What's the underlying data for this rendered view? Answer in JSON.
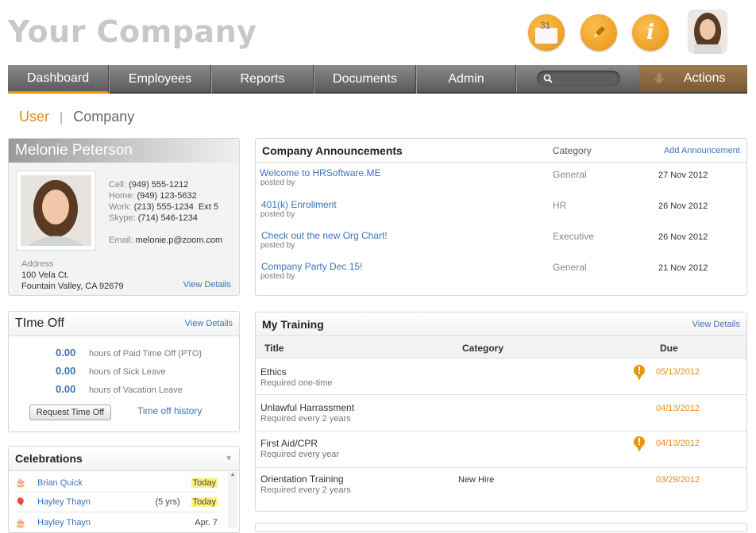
{
  "brand": {
    "logo": "Your Company"
  },
  "header": {
    "mail_badge": "31",
    "info_glyph": "i"
  },
  "nav": {
    "items": [
      "Dashboard",
      "Employees",
      "Reports",
      "Documents",
      "Admin"
    ],
    "actions": "Actions"
  },
  "context_tabs": {
    "user": "User",
    "separator": "|",
    "company": "Company"
  },
  "profile": {
    "name": "Melonie Peterson",
    "cell_label": "Cell:",
    "cell": "(949) 555-1212",
    "home_label": "Home:",
    "home": "(949) 123-5632",
    "work_label": "Work:",
    "work": "(213) 555-1234  Ext 5",
    "skype_label": "Skype:",
    "skype": "(714) 546-1234",
    "email_label": "Email:",
    "email": "melonie.p@zoom.com",
    "address_label": "Address",
    "address1": "100 Vela Ct.",
    "address2": "Fountain Valley, CA 92679",
    "view_details": "View Details"
  },
  "time_off": {
    "title": "TIme Off",
    "view_details": "View Details",
    "rows": [
      {
        "value": "0.00",
        "label": "hours of Paid Time Off (PTO)"
      },
      {
        "value": "0.00",
        "label": "hours of Sick Leave"
      },
      {
        "value": "0.00",
        "label": "hours of Vacation Leave"
      }
    ],
    "request_button": "Request Time Off",
    "history_link": "Time off history"
  },
  "celebrations": {
    "title": "Celebrations",
    "rows": [
      {
        "name": "Brian Quick",
        "years": "",
        "when": "Today"
      },
      {
        "name": "Hayley Thayn",
        "years": "(5 yrs)",
        "when": "Today"
      },
      {
        "name": "Hayley Thayn",
        "years": "",
        "when": "Apr. 7"
      }
    ]
  },
  "announcements": {
    "title": "Company Announcements",
    "category_header": "Category",
    "add_link": "Add Announcement",
    "rows": [
      {
        "title": "Welcome to HRSoftware.ME",
        "posted": "posted by",
        "category": "General",
        "date": "27 Nov 2012"
      },
      {
        "title": "401(k) Enrollment",
        "posted": "posted by",
        "category": "HR",
        "date": "26 Nov 2012"
      },
      {
        "title": "Check out the new Org Chart!",
        "posted": "posted by",
        "category": "Executive",
        "date": "26 Nov 2012"
      },
      {
        "title": "Company Party Dec 15!",
        "posted": "posted by",
        "category": "General",
        "date": "21 Nov 2012"
      }
    ]
  },
  "training": {
    "title": "My Training",
    "view_details": "View Details",
    "headers": {
      "title": "Title",
      "category": "Category",
      "due": "Due"
    },
    "rows": [
      {
        "title": "Ethics",
        "sub": "Required one-time",
        "category": "",
        "due": "05/13/2012",
        "alert": true
      },
      {
        "title": "Unlawful Harrassment",
        "sub": "Required every 2 years",
        "category": "",
        "due": "04/13/2012",
        "alert": false
      },
      {
        "title": "First Aid/CPR",
        "sub": "Required every year",
        "category": "",
        "due": "04/13/2012",
        "alert": true
      },
      {
        "title": "Orientation Training",
        "sub": "Required every 2 years",
        "category": "New Hire",
        "due": "03/29/2012",
        "alert": false
      }
    ]
  },
  "colors": {
    "accent": "#f29100",
    "link": "#3a73b8",
    "due": "#e58a13",
    "highlight": "#fff27a"
  }
}
